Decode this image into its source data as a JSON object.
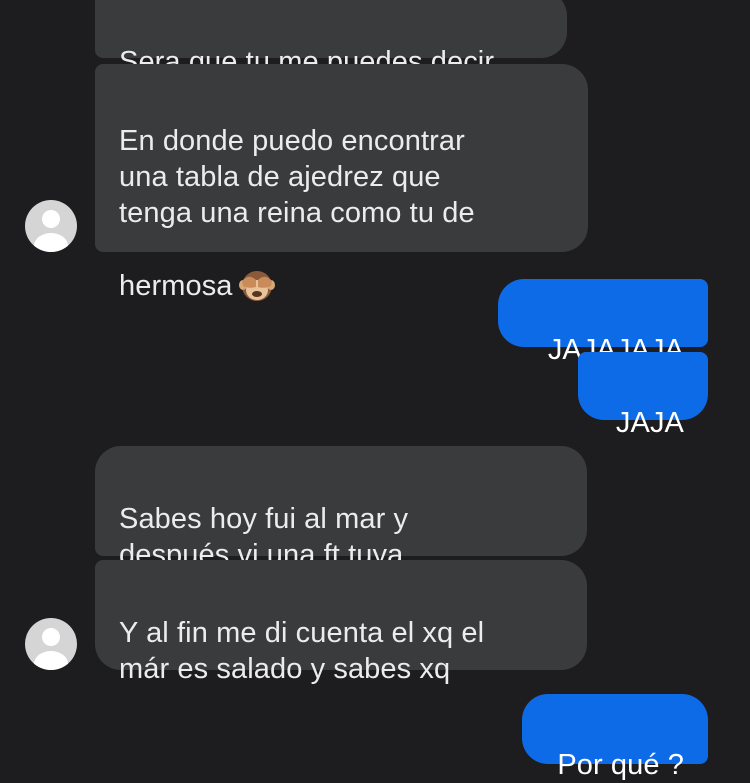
{
  "thread": {
    "incoming_group_1": [
      "Sera que tu me puedes decir",
      "En donde puedo encontrar\nuna tabla de ajedrez que\ntenga una reina como tu de\nhermosa"
    ],
    "emoji_name": "see-no-evil-monkey-icon",
    "outgoing_group_1": [
      "JAJAJAJA",
      "JAJA"
    ],
    "incoming_group_2": [
      "Sabes hoy fui al mar y\ndespués vi una ft tuya",
      "Y al fin me di cuenta el xq el\nmár es salado y sabes xq"
    ],
    "outgoing_group_2": [
      "Por qué ?"
    ]
  },
  "colors": {
    "background": "#1d1d1f",
    "incoming_bubble": "#3a3b3d",
    "outgoing_bubble": "#0e6be8",
    "avatar": "#d5d5d5"
  }
}
